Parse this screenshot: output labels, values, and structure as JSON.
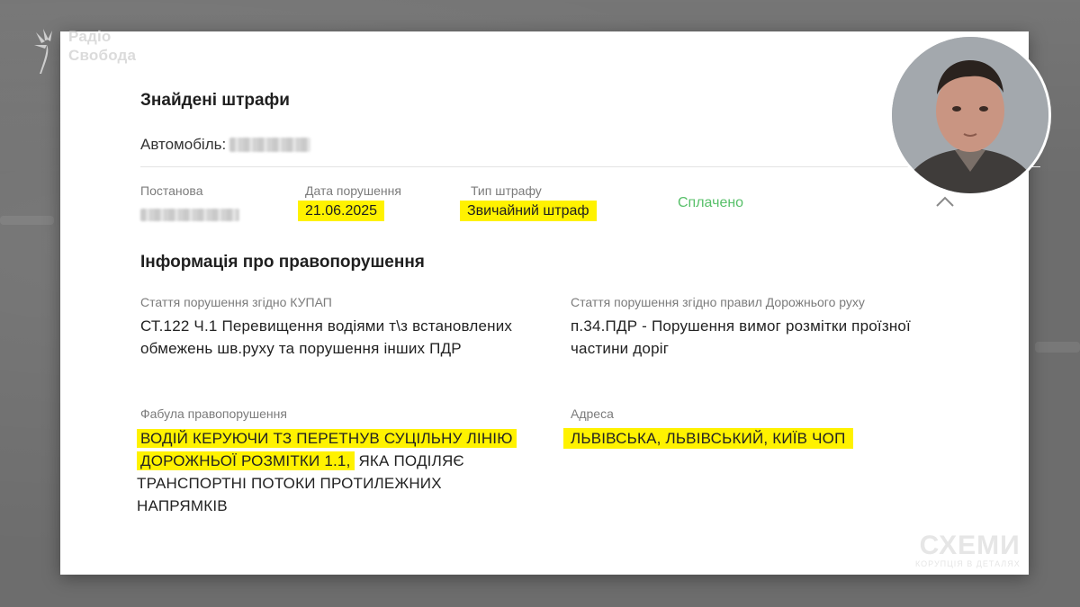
{
  "branding": {
    "radio_logo_line1": "Радіо",
    "radio_logo_line2": "Свобода",
    "watermark_title": "СХЕМИ",
    "watermark_subtitle": "КОРУПЦІЯ В ДЕТАЛЯХ"
  },
  "fines": {
    "title": "Знайдені штрафи",
    "car_label": "Автомобіль:",
    "columns": {
      "decree_label": "Постанова",
      "date_label": "Дата порушення",
      "type_label": "Тип штрафу"
    },
    "date_value": "21.06.2025",
    "type_value": "Звичайний штраф",
    "status": "Сплачено"
  },
  "violation": {
    "title": "Інформація про правопорушення",
    "kupap_label": "Стаття порушення згідно КУПАП",
    "kupap_value": "СТ.122 Ч.1 Перевищення водіями т\\з встановлених обмежень шв.руху та порушення інших ПДР",
    "pdr_label": "Стаття порушення згідно правил Дорожнього руху",
    "pdr_value": "п.34.ПДР - Порушення вимог розмітки проїзної частини доріг",
    "fabula_label": "Фабула правопорушення",
    "fabula_highlighted": "ВОДІЙ КЕРУЮЧИ ТЗ ПЕРЕТНУВ СУЦІЛЬНУ ЛІНІЮ ДОРОЖНЬОЇ РОЗМІТКИ 1.1,",
    "fabula_rest": " ЯКА ПОДІЛЯЄ ТРАНСПОРТНІ ПОТОКИ ПРОТИЛЕЖНИХ НАПРЯМКІВ",
    "address_label": "Адреса",
    "address_value": "ЛЬВІВСЬКА, ЛЬВІВСЬКИЙ, КИЇВ ЧОП"
  },
  "colors": {
    "highlight": "#fff200",
    "status_green": "#58c06a"
  }
}
